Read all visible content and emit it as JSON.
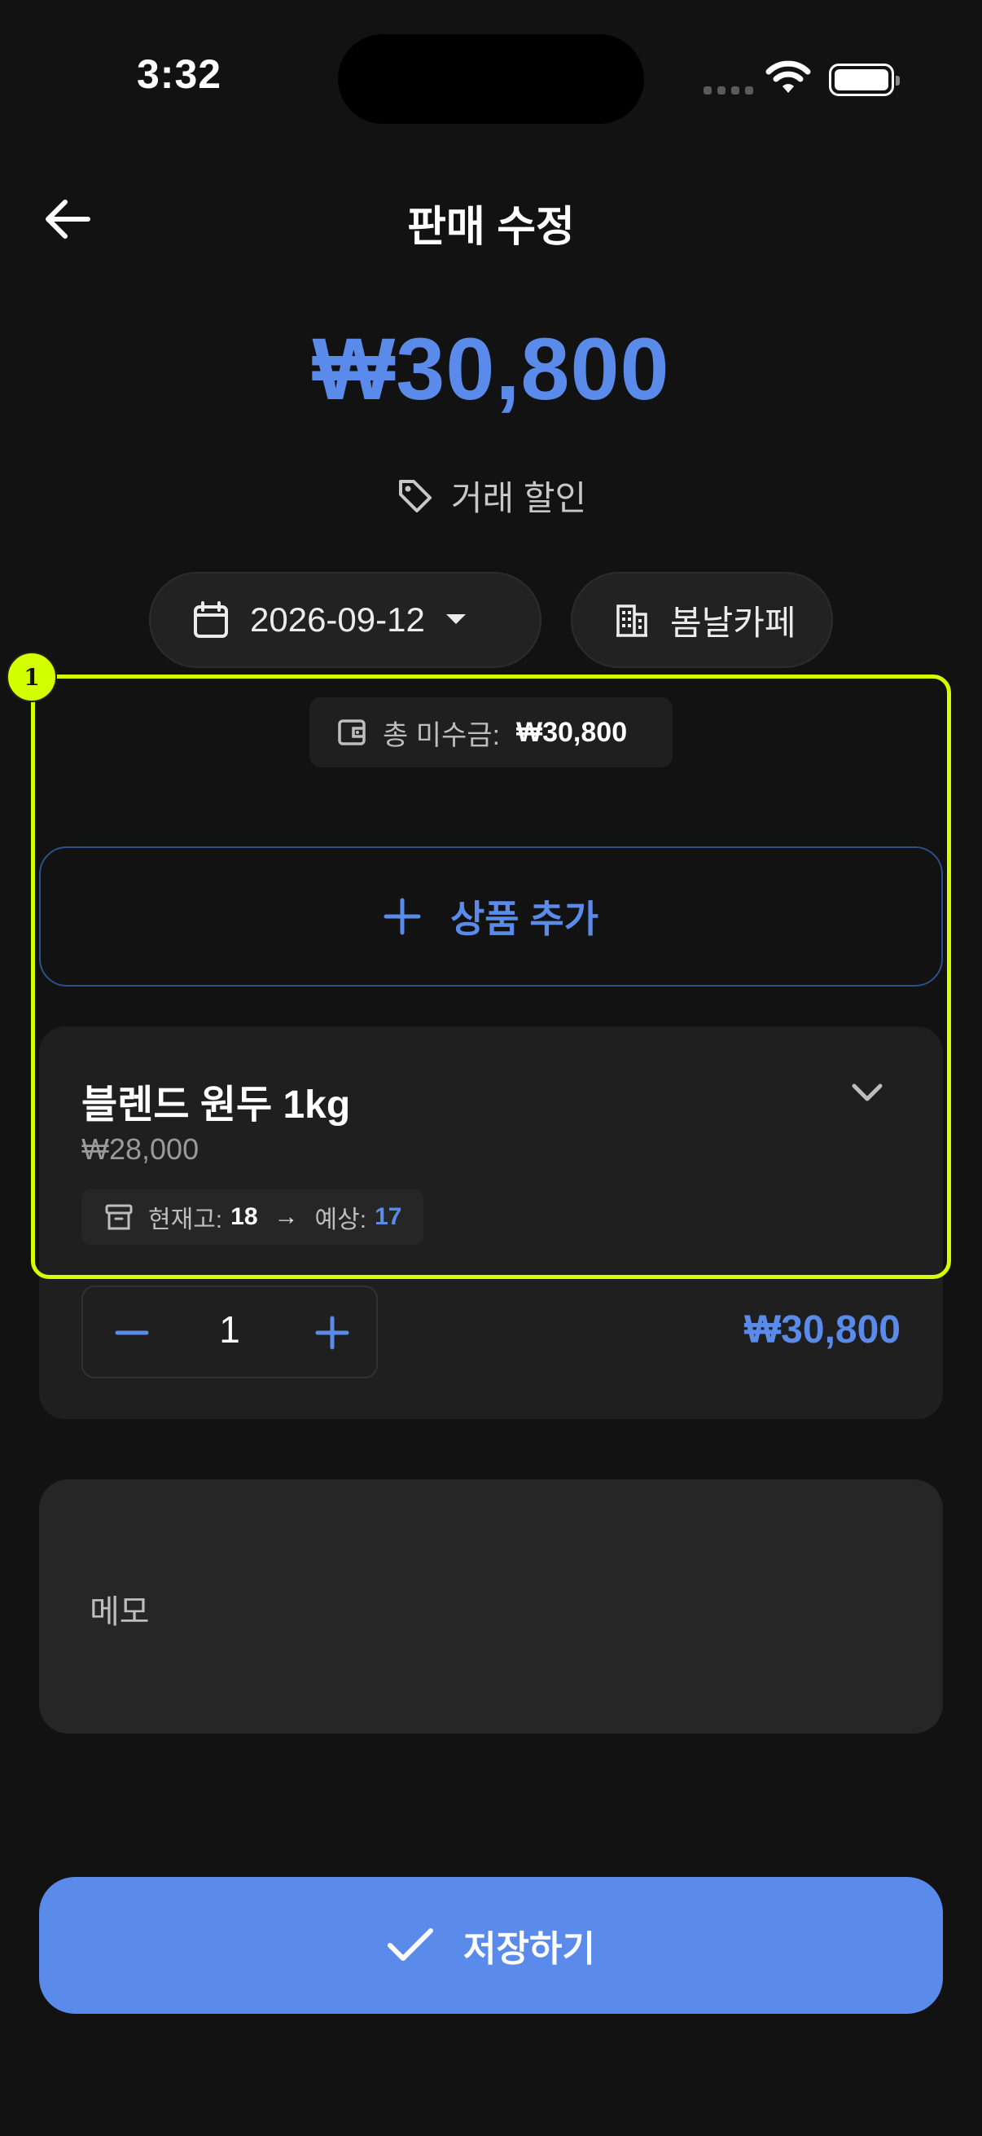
{
  "status_bar": {
    "time": "3:32"
  },
  "header": {
    "title": "판매 수정"
  },
  "sale": {
    "amount": "₩30,800",
    "discount_label": "거래 할인"
  },
  "filters": {
    "date": "2026-09-12",
    "store": "봄날카페"
  },
  "summary": {
    "owed_label": "총 미수금:",
    "owed_value": "₩30,800"
  },
  "actions": {
    "add_product_label": "상품 추가",
    "save_label": "저장하기"
  },
  "product": {
    "name": "블렌드 원두 1kg",
    "unit_price": "₩28,000",
    "stock_label": "현재고:",
    "stock_current": "18",
    "stock_arrow": "→",
    "expected_label": "예상:",
    "stock_expected": "17",
    "quantity": "1",
    "line_total": "₩30,800"
  },
  "memo": {
    "placeholder": "메모"
  },
  "annotation": {
    "badge": "1"
  },
  "colors": {
    "accent": "#5b8bea",
    "background": "#121212",
    "highlight": "#d4ff00"
  }
}
